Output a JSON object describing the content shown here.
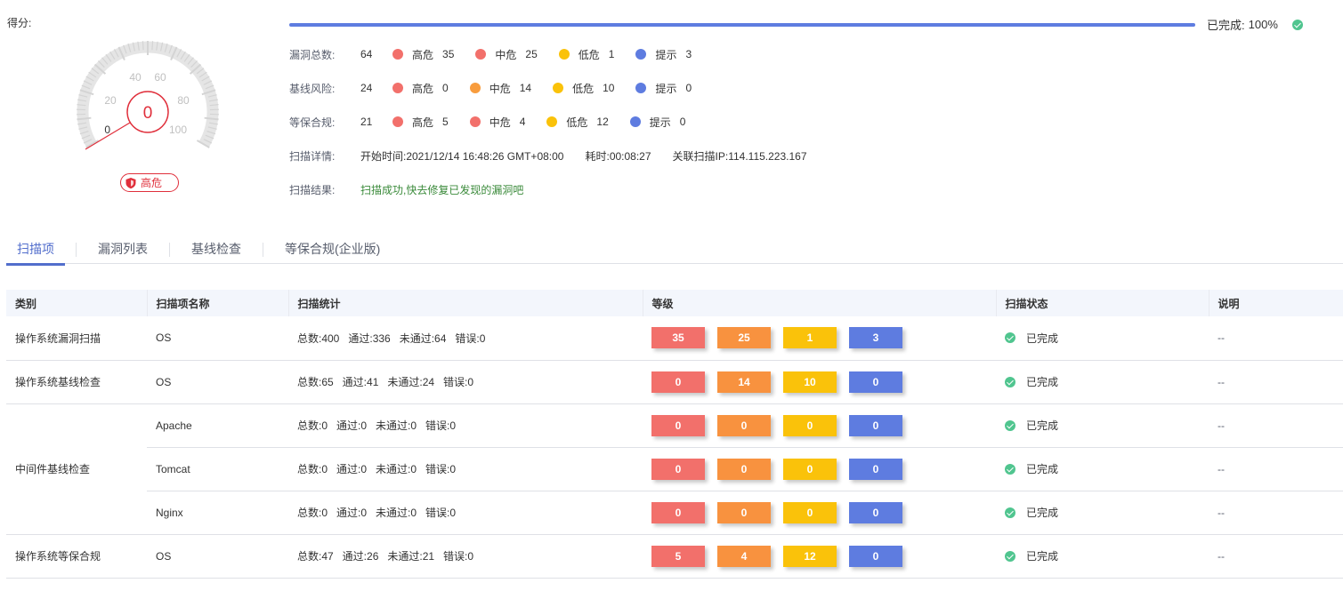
{
  "score": {
    "label": "得分:",
    "value": "0",
    "ticks": [
      "0",
      "20",
      "40",
      "60",
      "80",
      "100"
    ],
    "risk_label": "高危",
    "risk_color": "#e02f3b"
  },
  "progress": {
    "label": "已完成:",
    "percent_text": "100%",
    "percent_value": 100
  },
  "colors": {
    "high": "#f2706b",
    "medium": "#f89c3d",
    "low": "#fac20a",
    "info": "#5e7ce0",
    "high_orange": "#f8923f"
  },
  "summary": {
    "vulns": {
      "label": "漏洞总数:",
      "total": "64",
      "items": [
        {
          "name": "高危",
          "count": "35",
          "color": "#f2706b"
        },
        {
          "name": "中危",
          "count": "25",
          "color": "#f2706b"
        },
        {
          "name": "低危",
          "count": "1",
          "color": "#fac20a"
        },
        {
          "name": "提示",
          "count": "3",
          "color": "#5e7ce0"
        }
      ]
    },
    "baseline": {
      "label": "基线风险:",
      "total": "24",
      "items": [
        {
          "name": "高危",
          "count": "0",
          "color": "#f2706b"
        },
        {
          "name": "中危",
          "count": "14",
          "color": "#f89c3d"
        },
        {
          "name": "低危",
          "count": "10",
          "color": "#fac20a"
        },
        {
          "name": "提示",
          "count": "0",
          "color": "#5e7ce0"
        }
      ]
    },
    "compliance": {
      "label": "等保合规:",
      "total": "21",
      "items": [
        {
          "name": "高危",
          "count": "5",
          "color": "#f2706b"
        },
        {
          "name": "中危",
          "count": "4",
          "color": "#f2706b"
        },
        {
          "name": "低危",
          "count": "12",
          "color": "#fac20a"
        },
        {
          "name": "提示",
          "count": "0",
          "color": "#5e7ce0"
        }
      ]
    },
    "details": {
      "label": "扫描详情:",
      "start": "开始时间:2021/12/14 16:48:26 GMT+08:00",
      "duration": "耗时:00:08:27",
      "ip": "关联扫描IP:114.115.223.167"
    },
    "result": {
      "label": "扫描结果:",
      "text": "扫描成功,快去修复已发现的漏洞吧"
    }
  },
  "tabs": [
    "扫描项",
    "漏洞列表",
    "基线检查",
    "等保合规(企业版)"
  ],
  "table": {
    "headers": [
      "类别",
      "扫描项名称",
      "扫描统计",
      "等级",
      "扫描状态",
      "说明"
    ],
    "groups": [
      {
        "category": "操作系统漏洞扫描",
        "rows": [
          {
            "name": "OS",
            "stats": "总数:400   通过:336   未通过:64   错误:0",
            "levels": [
              "35",
              "25",
              "1",
              "3"
            ],
            "status": "已完成",
            "desc": "--"
          }
        ]
      },
      {
        "category": "操作系统基线检查",
        "rows": [
          {
            "name": "OS",
            "stats": "总数:65   通过:41   未通过:24   错误:0",
            "levels": [
              "0",
              "14",
              "10",
              "0"
            ],
            "status": "已完成",
            "desc": "--"
          }
        ]
      },
      {
        "category": "中间件基线检查",
        "rows": [
          {
            "name": "Apache",
            "stats": "总数:0   通过:0   未通过:0   错误:0",
            "levels": [
              "0",
              "0",
              "0",
              "0"
            ],
            "status": "已完成",
            "desc": "--"
          },
          {
            "name": "Tomcat",
            "stats": "总数:0   通过:0   未通过:0   错误:0",
            "levels": [
              "0",
              "0",
              "0",
              "0"
            ],
            "status": "已完成",
            "desc": "--"
          },
          {
            "name": "Nginx",
            "stats": "总数:0   通过:0   未通过:0   错误:0",
            "levels": [
              "0",
              "0",
              "0",
              "0"
            ],
            "status": "已完成",
            "desc": "--"
          }
        ]
      },
      {
        "category": "操作系统等保合规",
        "rows": [
          {
            "name": "OS",
            "stats": "总数:47   通过:26   未通过:21   错误:0",
            "levels": [
              "5",
              "4",
              "12",
              "0"
            ],
            "status": "已完成",
            "desc": "--"
          }
        ]
      }
    ]
  }
}
